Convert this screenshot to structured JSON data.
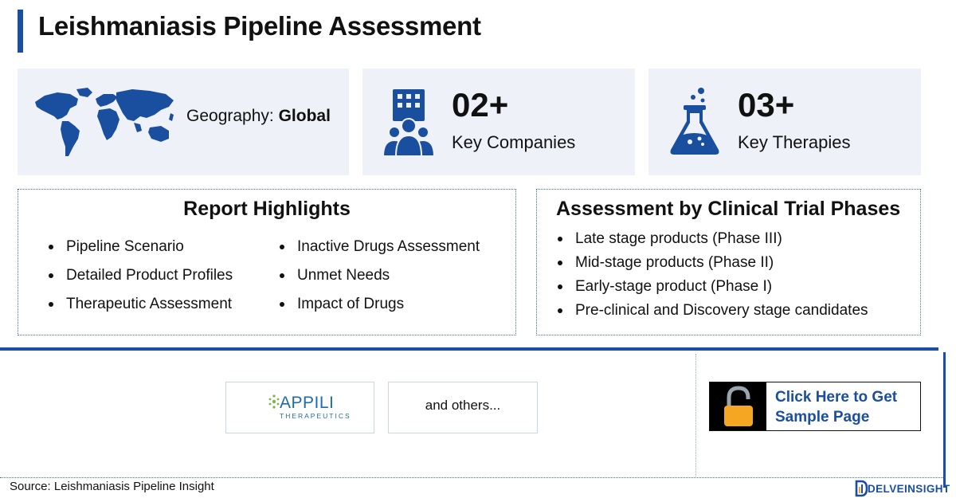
{
  "header": {
    "title": "Leishmaniasis Pipeline Assessment"
  },
  "geography": {
    "label": "Geography: ",
    "value": "Global",
    "icon": "world-map-icon"
  },
  "companies": {
    "number": "02+",
    "label": "Key Companies",
    "icon": "building-people-icon"
  },
  "therapies": {
    "number": "03+",
    "label": "Key Therapies",
    "icon": "flask-icon"
  },
  "highlights": {
    "title": "Report Highlights",
    "col1": [
      "Pipeline Scenario",
      "Detailed Product Profiles",
      "Therapeutic Assessment"
    ],
    "col2": [
      "Inactive Drugs Assessment",
      "Unmet Needs",
      "Impact of Drugs"
    ]
  },
  "phases": {
    "title": "Assessment by Clinical Trial Phases",
    "items": [
      "Late stage products (Phase III)",
      "Mid-stage products (Phase II)",
      "Early-stage product (Phase I)",
      "Pre-clinical and Discovery stage candidates"
    ]
  },
  "companies_logos": {
    "appili": {
      "name": "APPILI",
      "sub": "THERAPEUTICS"
    },
    "others": "and others..."
  },
  "cta": {
    "label": "Click Here to Get Sample Page",
    "icon": "unlock-icon"
  },
  "footer": {
    "source": "Source: Leishmaniasis Pipeline Insight",
    "brand": "DELVEINSIGHT"
  },
  "colors": {
    "accent": "#1a4fa0",
    "card_bg": "#eef2f8",
    "lock": "#f5a623"
  }
}
